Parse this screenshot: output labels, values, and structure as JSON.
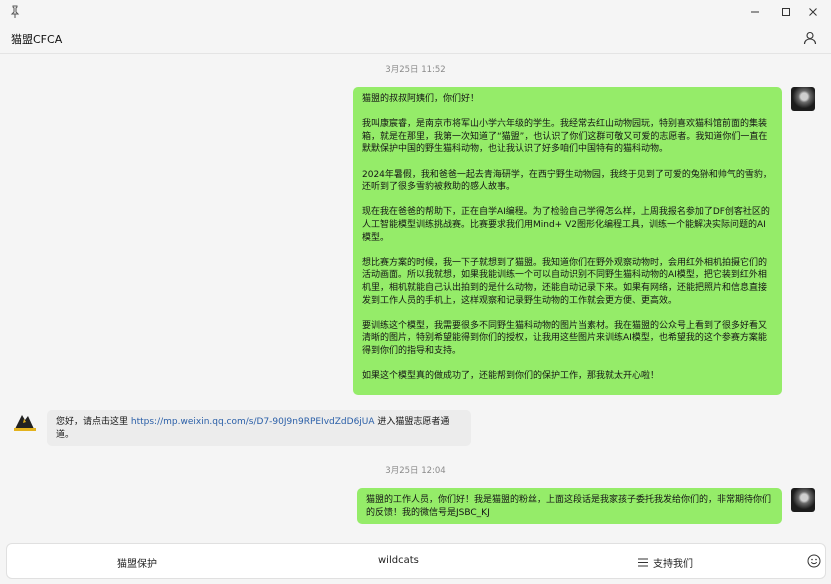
{
  "window": {
    "pin_icon": "pin-icon",
    "minimize_icon": "minimize-icon",
    "maximize_icon": "maximize-icon",
    "close_icon": "close-icon"
  },
  "header": {
    "title": "猫盟CFCA",
    "profile_icon": "person-icon"
  },
  "messages": {
    "ts1": "3月25日 11:52",
    "msg1": "猫盟的叔叔阿姨们，你们好！\n\n我叫康宸睿，是南京市将军山小学六年级的学生。我经常去红山动物园玩，特别喜欢猫科馆前面的集装箱，就是在那里，我第一次知道了“猫盟”，也认识了你们这群可敬又可爱的志愿者。我知道你们一直在默默保护中国的野生猫科动物，也让我认识了好多咱们中国特有的猫科动物。\n\n2024年暑假，我和爸爸一起去青海研学，在西宁野生动物园，我终于见到了可爱的兔狲和帅气的雪豹，还听到了很多雪豹被救助的感人故事。\n\n现在我在爸爸的帮助下，正在自学AI编程。为了检验自己学得怎么样，上周我报名参加了DF创客社区的人工智能模型训练挑战赛。比赛要求我们用Mind+ V2图形化编程工具，训练一个能解决实际问题的AI模型。\n\n想比赛方案的时候，我一下子就想到了猫盟。我知道你们在野外观察动物时，会用红外相机拍摄它们的活动画面。所以我就想，如果我能训练一个可以自动识别不同野生猫科动物的AI模型，把它装到红外相机里，相机就能自己认出拍到的是什么动物，还能自动记录下来。如果有网络，还能把照片和信息直接发到工作人员的手机上，这样观察和记录野生动物的工作就会更方便、更高效。\n\n要训练这个模型，我需要很多不同野生猫科动物的图片当素材。我在猫盟的公众号上看到了很多好看又清晰的图片，特别希望能得到你们的授权，让我用这些图片来训练AI模型，也希望我的这个参赛方案能得到你们的指导和支持。\n\n如果这个模型真的做成功了，还能帮到你们的保护工作，那我就太开心啦！",
    "msg2_prefix": "您好，请点击这里 ",
    "msg2_link": "https://mp.weixin.qq.com/s/D7-90J9n9RPEIvdZdD6jUA",
    "msg2_suffix": " 进入猫盟志愿者通道。",
    "ts2": "3月25日 12:04",
    "msg3": "猫盟的工作人员，你们好！我是猫盟的粉丝，上面这段话是我家孩子委托我发给你们的，非常期待你们的反馈！我的微信号是JSBC_KJ"
  },
  "bottom_menu": {
    "item1": "猫盟保护",
    "item2": "wildcats",
    "item3": "支持我们",
    "menu_icon": "hamburger-icon",
    "emoji_icon": "emoji-icon"
  }
}
